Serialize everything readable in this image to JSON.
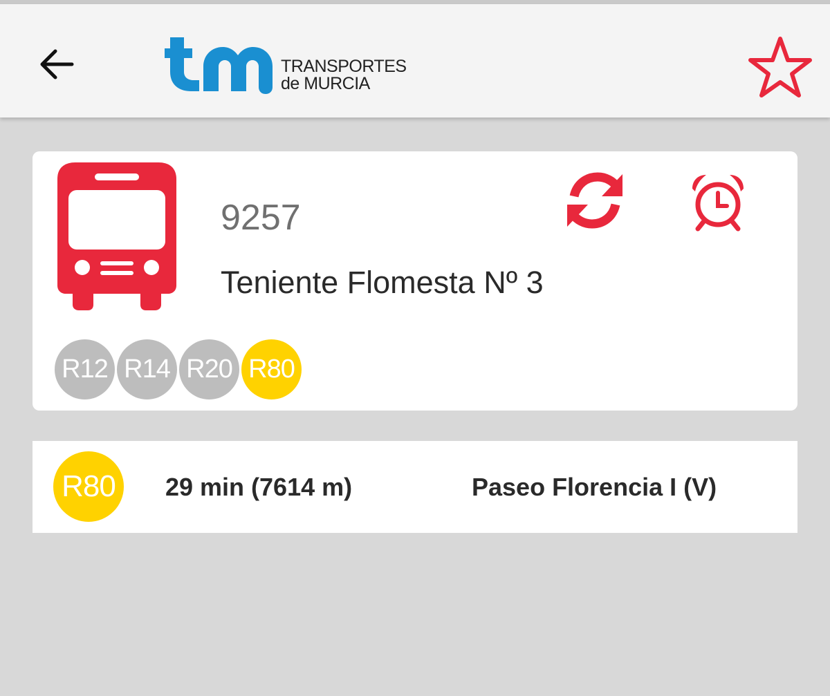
{
  "appbar": {
    "back_icon": "arrow-left-icon",
    "logo": {
      "mark": "tm",
      "line1": "TRANSPORTES",
      "line2": "de MURCIA",
      "color": "#1a8fd1"
    },
    "favorite_icon": "star-outline-icon",
    "accent_color": "#e8283c"
  },
  "stop": {
    "icon": "bus-icon",
    "number": "9257",
    "name": "Teniente Flomesta Nº 3",
    "actions": [
      {
        "icon": "refresh-icon"
      },
      {
        "icon": "alarm-clock-icon"
      }
    ],
    "lines": [
      {
        "label": "R12",
        "color": "#bdbdbd"
      },
      {
        "label": "R14",
        "color": "#bdbdbd"
      },
      {
        "label": "R20",
        "color": "#bdbdbd"
      },
      {
        "label": "R80",
        "color": "#ffd200"
      }
    ]
  },
  "arrivals": [
    {
      "line": "R80",
      "line_color": "#ffd200",
      "time": "29 min (7614 m)",
      "destination": "Paseo Florencia I (V)"
    }
  ]
}
